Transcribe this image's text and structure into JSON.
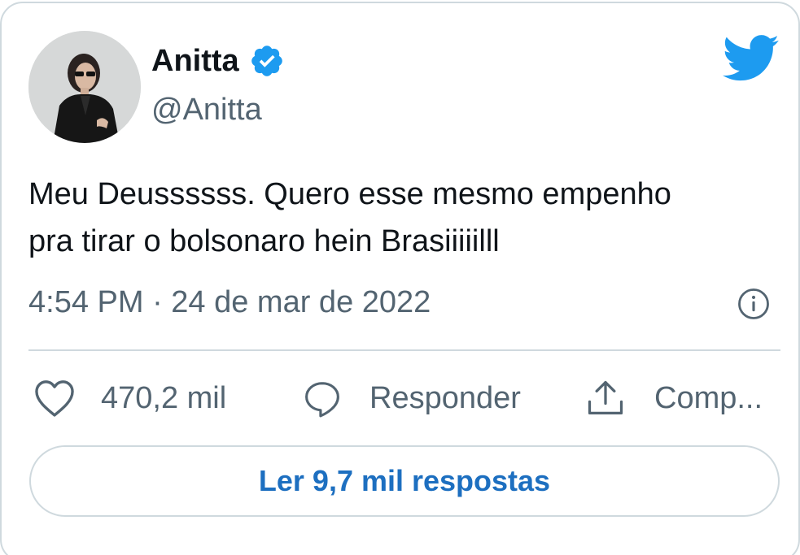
{
  "tweet": {
    "author": {
      "display_name": "Anitta",
      "handle": "@Anitta",
      "verified": true,
      "avatar_icon": "profile-photo"
    },
    "text_lines": [
      "Meu Deussssss. Quero esse mesmo empenho",
      "pra tirar o bolsonaro hein Brasiiiiilll"
    ],
    "timestamp": "4:54 PM · 24 de mar de 2022",
    "actions": {
      "like_count": "470,2 mil",
      "reply_label": "Responder",
      "share_label": "Comp..."
    },
    "read_replies_label": "Ler 9,7 mil respostas"
  },
  "icons": {
    "brand": "twitter-bird-icon",
    "verified": "verified-badge-icon",
    "info": "info-icon",
    "like": "heart-icon",
    "reply": "speech-bubble-icon",
    "share": "share-upload-icon"
  },
  "colors": {
    "twitter_blue": "#1d9bf0",
    "link_blue": "#1d6fc0",
    "text_primary": "#0f1419",
    "text_secondary": "#536471",
    "border": "#cfd9de"
  }
}
